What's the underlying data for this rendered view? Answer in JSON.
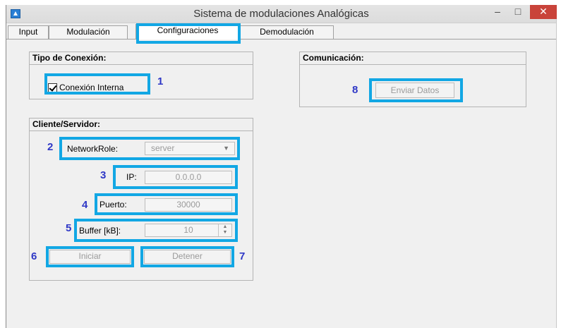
{
  "window": {
    "title": "Sistema de modulaciones Analógicas",
    "controls": {
      "minimize": "–",
      "maximize": "□",
      "close": "✕"
    }
  },
  "tabs": [
    {
      "label": "Input"
    },
    {
      "label": "Modulación"
    },
    {
      "label": "Configuraciones",
      "selected": true
    },
    {
      "label": "Demodulación"
    }
  ],
  "tipo_conexion": {
    "title": "Tipo de Conexión:",
    "checkbox_label": "Conexión Interna",
    "checked": true
  },
  "comunicacion": {
    "title": "Comunicación:",
    "send_button": "Enviar Datos"
  },
  "cliente_servidor": {
    "title": "Cliente/Servidor:",
    "network_role_label": "NetworkRole:",
    "network_role_value": "server",
    "ip_label": "IP:",
    "ip_value": "0.0.0.0",
    "port_label": "Puerto:",
    "port_value": "30000",
    "buffer_label": "Buffer [kB]:",
    "buffer_value": "10",
    "start_button": "Iniciar",
    "stop_button": "Detener"
  },
  "badges": [
    "1",
    "2",
    "3",
    "4",
    "5",
    "6",
    "7",
    "8"
  ],
  "colors": {
    "highlight": "#12a7e4",
    "badge": "#2e37c6",
    "close_button": "#c9433a"
  }
}
